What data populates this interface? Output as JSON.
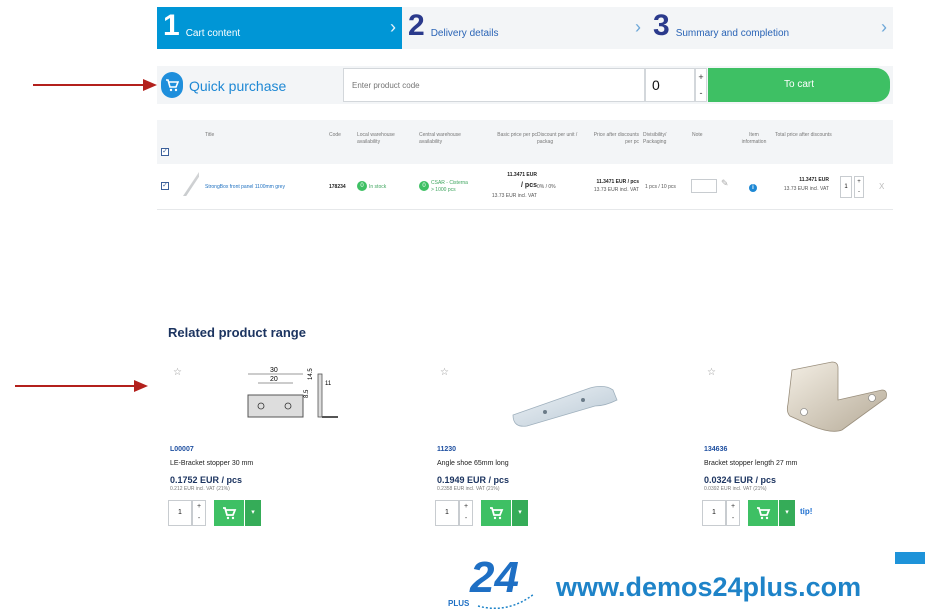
{
  "steps": [
    {
      "num": "1",
      "label": "Cart content",
      "active": true
    },
    {
      "num": "2",
      "label": "Delivery details",
      "active": false
    },
    {
      "num": "3",
      "label": "Summary and completion",
      "active": false
    }
  ],
  "quick_purchase": {
    "title": "Quick purchase",
    "placeholder": "Enter product code",
    "quantity": "0",
    "plus": "+",
    "minus": "-",
    "to_cart": "To cart"
  },
  "cart_table": {
    "headers": {
      "title": "Title",
      "code": "Code",
      "local": "Local warehouse availability",
      "central": "Central warehouse availability",
      "basic_price": "Basic price per pc",
      "discount": "Discount per unit / packag",
      "price_after": "Price after discounts per pc",
      "divisibility": "Divisibility/ Packaging",
      "note": "Note",
      "item_info": "Item information",
      "total": "Total price after discounts"
    },
    "row": {
      "title": "StrongBox front panel 1100mm grey",
      "code": "178234",
      "local_badge": "0",
      "local_text": "In stock",
      "central_badge": "0",
      "central_text": "CSAR - Cisterna > 1000 pcs",
      "basic_price": "11.3471 EUR",
      "basic_unit": "/ pcs",
      "basic_vat": "13.73 EUR incl. VAT",
      "discount": "0% / 0%",
      "price_after": "11.3471 EUR / pcs",
      "price_after_vat": "13.73 EUR incl. VAT",
      "divisibility": "1 pcs / 10 pcs",
      "total": "11.3471 EUR",
      "total_vat": "13.73 EUR incl. VAT",
      "qty": "1",
      "remove": "X"
    }
  },
  "related": {
    "title": "Related product range",
    "items": [
      {
        "code": "L00007",
        "name": "LE-Bracket stopper 30 mm",
        "price": "0.1752 EUR / pcs",
        "vat": "0.212 EUR incl. VAT (21%)",
        "qty": "1",
        "tip": ""
      },
      {
        "code": "11230",
        "name": "Angle shoe 65mm long",
        "price": "0.1949 EUR / pcs",
        "vat": "0.2358 EUR incl. VAT (21%)",
        "qty": "1",
        "tip": ""
      },
      {
        "code": "134636",
        "name": "Bracket stopper length 27 mm",
        "price": "0.0324 EUR / pcs",
        "vat": "0.0392 EUR incl. VAT (21%)",
        "qty": "1",
        "tip": "tip!"
      }
    ],
    "drawing_dims": [
      "30",
      "20",
      "14.5",
      "8.5",
      "11"
    ]
  },
  "footer": {
    "logo_number": "24",
    "logo_plus": "PLUS",
    "url": "www.demos24plus.com"
  },
  "colors": {
    "accent_blue": "#0096d6",
    "green": "#3ec064",
    "arrow_red": "#b3201c"
  }
}
